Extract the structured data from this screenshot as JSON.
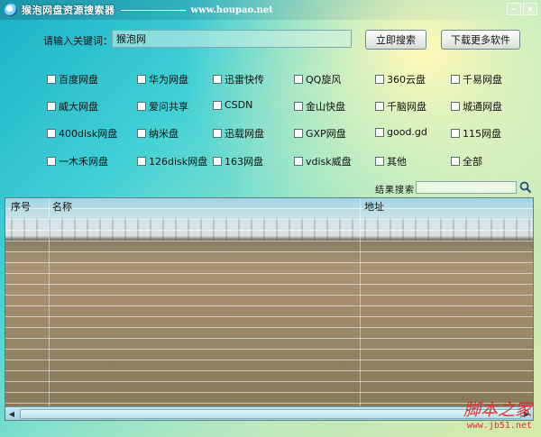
{
  "titlebar": {
    "title": "猴泡网盘资源搜索器",
    "url": "www.houpao.net"
  },
  "search": {
    "keyword_label": "请输入关键词：",
    "keyword_value": "猴泡网",
    "search_button": "立即搜索",
    "more_button": "下载更多软件"
  },
  "sources": [
    "百度网盘",
    "华为网盘",
    "迅雷快传",
    "QQ旋风",
    "360云盘",
    "千易网盘",
    "威大网盘",
    "爱问共享",
    "CSDN",
    "金山快盘",
    "千脑网盘",
    "城通网盘",
    "400disk网盘",
    "纳米盘",
    "迅载网盘",
    "GXP网盘",
    "good.gd",
    "115网盘",
    "一木禾网盘",
    "126disk网盘",
    "163网盘",
    "vdisk威盘",
    "其他",
    "全部"
  ],
  "results": {
    "filter_label": "结果搜索",
    "filter_value": "",
    "columns": [
      "序号",
      "名称",
      "地址"
    ]
  },
  "watermark": {
    "main": "脚本之家",
    "sub": "www.jb51.net"
  },
  "colors": {
    "accent": "#1fb1c7",
    "watermark": "#dd3333"
  }
}
